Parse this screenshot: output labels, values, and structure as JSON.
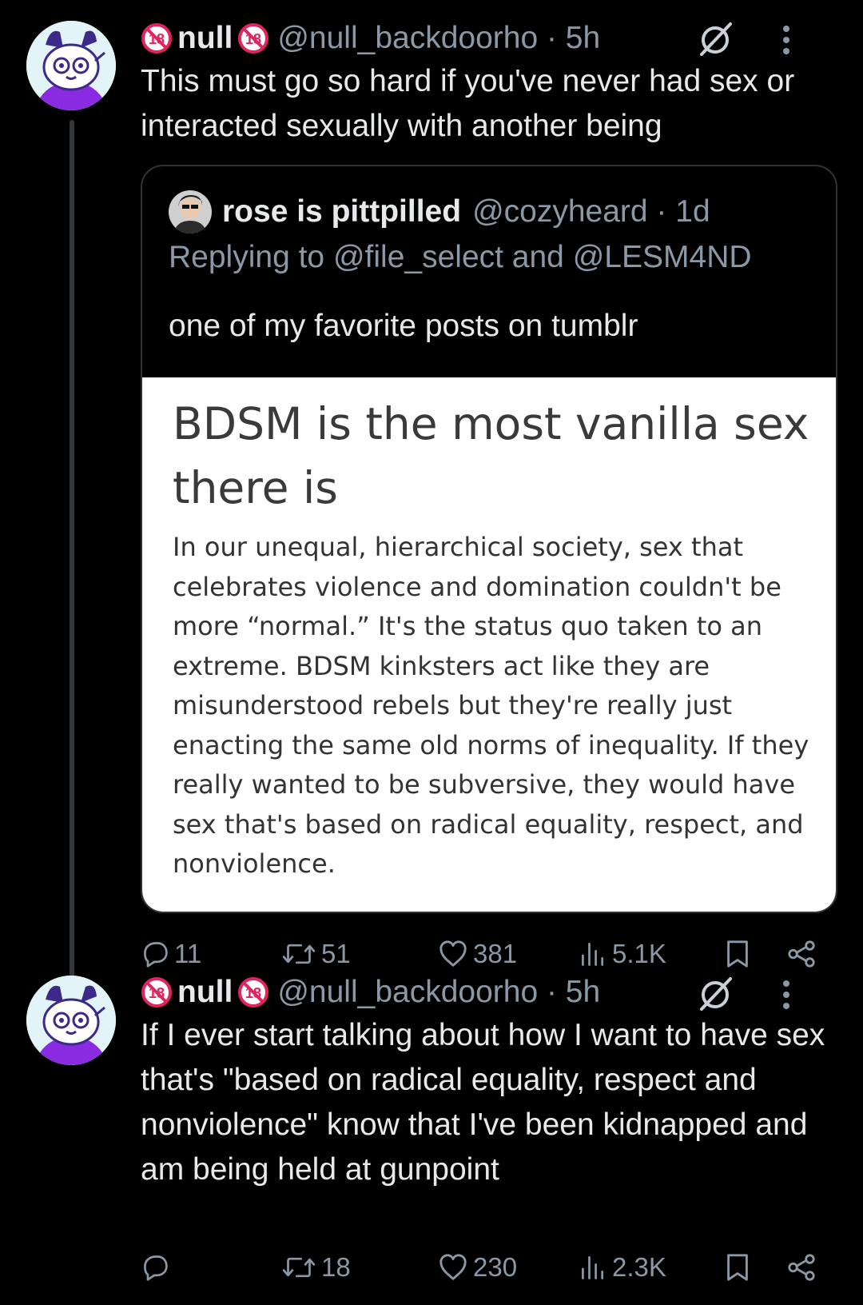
{
  "tweets": [
    {
      "author_name": "null",
      "handle": "@null_backdoorho · 5h",
      "text": "This must go so hard if you've never had sex or interacted sexually with another being",
      "quote": {
        "author_name": "rose is pittpilled",
        "handle": "@cozyheard · 1d",
        "replying_to": "Replying to @file_select and @LESM4ND",
        "text": "one of my favorite posts on tumblr",
        "image": {
          "title": "BDSM is the most vanilla sex there is",
          "body": "In our unequal, hierarchical society, sex that celebrates violence and domination couldn't be more “normal.” It's the status quo taken to an extreme. BDSM kinksters act like they are misunderstood rebels but they're really just enacting the same old norms of inequality. If they really wanted to be subversive, they would have sex that's based on radical equality, respect, and nonviolence."
        }
      },
      "stats": {
        "replies": "11",
        "reposts": "51",
        "likes": "381",
        "views": "5.1K"
      }
    },
    {
      "author_name": "null",
      "handle": "@null_backdoorho · 5h",
      "text": "If I ever start talking about how I want to have sex that's \"based on radical equality, respect and nonviolence\" know that I've been kidnapped and am being held at gunpoint",
      "stats": {
        "replies": "",
        "reposts": "18",
        "likes": "230",
        "views": "2.3K"
      }
    }
  ],
  "icons": {
    "age_badge": "18-plus-badge-icon",
    "verified": "verified-slash-icon",
    "more": "more-vertical-icon",
    "reply": "reply-icon",
    "repost": "repost-icon",
    "like": "heart-icon",
    "views": "views-icon",
    "bookmark": "bookmark-icon",
    "share": "share-icon"
  },
  "colors": {
    "background": "#000000",
    "text": "#e7e9ea",
    "secondary": "#8b98a5",
    "border": "#2f3336",
    "badge_red": "#e0245e"
  }
}
